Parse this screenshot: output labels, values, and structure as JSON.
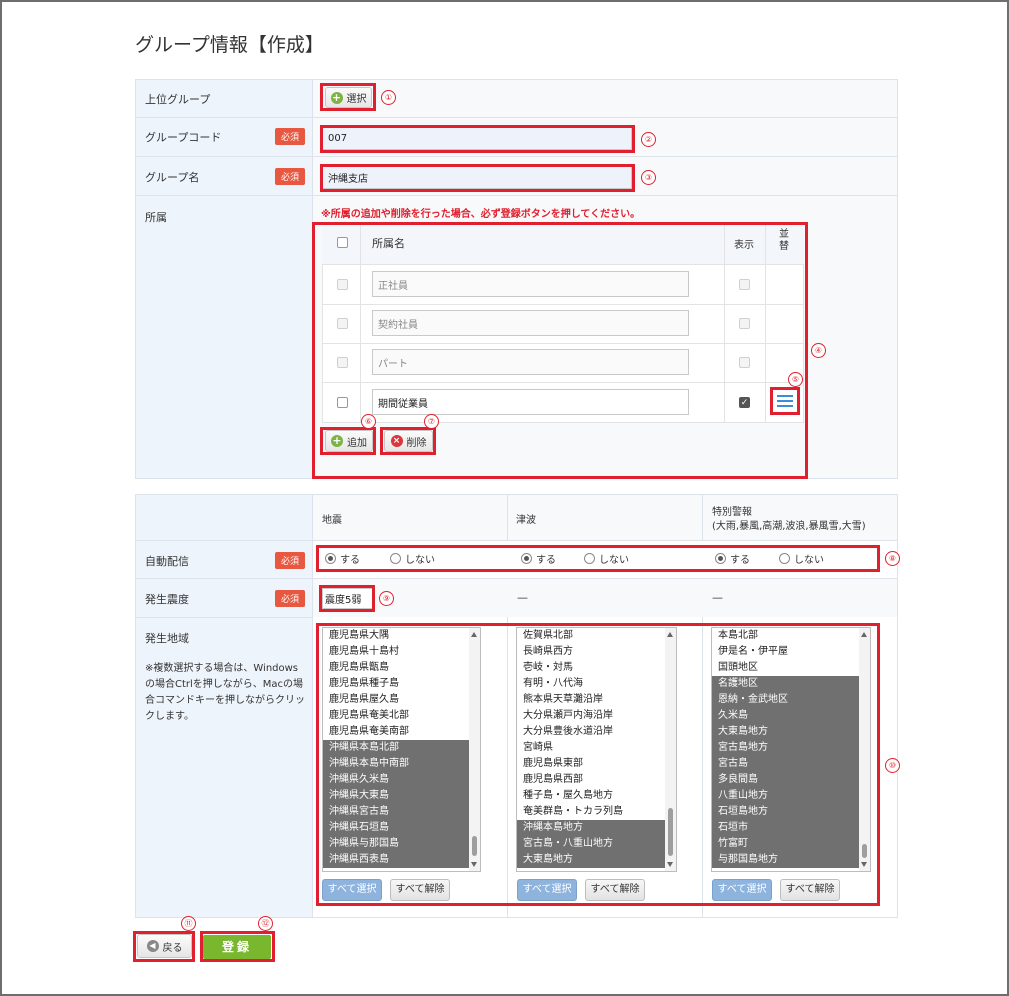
{
  "page_title": "グループ情報【作成】",
  "form": {
    "parent_group": {
      "label": "上位グループ",
      "button": "選択"
    },
    "group_code": {
      "label": "グループコード",
      "required": "必須",
      "value": "007"
    },
    "group_name": {
      "label": "グループ名",
      "required": "必須",
      "value": "沖縄支店"
    },
    "affiliation": {
      "label": "所属",
      "notice": "※所属の追加や削除を行った場合、必ず登録ボタンを押してください。",
      "col_name": "所属名",
      "col_display": "表示",
      "col_sort": "並替",
      "rows": [
        {
          "name": "正社員"
        },
        {
          "name": "契約社員"
        },
        {
          "name": "パート"
        },
        {
          "name": "期間従業員"
        }
      ],
      "add_button": "追加",
      "delete_button": "削除"
    }
  },
  "delivery": {
    "columns": {
      "quake": "地震",
      "tsunami": "津波",
      "warning": "特別警報",
      "warning_sub": "(大雨,暴風,高潮,波浪,暴風雪,大雪)"
    },
    "auto": {
      "label": "自動配信",
      "required": "必須",
      "yes": "する",
      "no": "しない"
    },
    "intensity": {
      "label": "発生震度",
      "required": "必須",
      "value": "震度5弱",
      "tsunami_value": "—",
      "warning_value": "—"
    },
    "region": {
      "label": "発生地域",
      "note": "※複数選択する場合は、Windowsの場合Ctrlを押しながら、Macの場合コマンドキーを押しながらクリックします。",
      "select_all": "すべて選択",
      "clear_all": "すべて解除",
      "quake_items": [
        {
          "t": "鹿児島県大隅",
          "s": false
        },
        {
          "t": "鹿児島県十島村",
          "s": false
        },
        {
          "t": "鹿児島県甑島",
          "s": false
        },
        {
          "t": "鹿児島県種子島",
          "s": false
        },
        {
          "t": "鹿児島県屋久島",
          "s": false
        },
        {
          "t": "鹿児島県奄美北部",
          "s": false
        },
        {
          "t": "鹿児島県奄美南部",
          "s": false
        },
        {
          "t": "沖縄県本島北部",
          "s": true
        },
        {
          "t": "沖縄県本島中南部",
          "s": true
        },
        {
          "t": "沖縄県久米島",
          "s": true
        },
        {
          "t": "沖縄県大東島",
          "s": true
        },
        {
          "t": "沖縄県宮古島",
          "s": true
        },
        {
          "t": "沖縄県石垣島",
          "s": true
        },
        {
          "t": "沖縄県与那国島",
          "s": true
        },
        {
          "t": "沖縄県西表島",
          "s": true
        }
      ],
      "tsunami_items": [
        {
          "t": "佐賀県北部",
          "s": false
        },
        {
          "t": "長崎県西方",
          "s": false
        },
        {
          "t": "壱岐・対馬",
          "s": false
        },
        {
          "t": "有明・八代海",
          "s": false
        },
        {
          "t": "熊本県天草灘沿岸",
          "s": false
        },
        {
          "t": "大分県瀬戸内海沿岸",
          "s": false
        },
        {
          "t": "大分県豊後水道沿岸",
          "s": false
        },
        {
          "t": "宮崎県",
          "s": false
        },
        {
          "t": "鹿児島県東部",
          "s": false
        },
        {
          "t": "鹿児島県西部",
          "s": false
        },
        {
          "t": "種子島・屋久島地方",
          "s": false
        },
        {
          "t": "奄美群島・トカラ列島",
          "s": false
        },
        {
          "t": "沖縄本島地方",
          "s": true
        },
        {
          "t": "宮古島・八重山地方",
          "s": true
        },
        {
          "t": "大東島地方",
          "s": true
        }
      ],
      "warning_items": [
        {
          "t": "本島北部",
          "s": false
        },
        {
          "t": "伊是名・伊平屋",
          "s": false
        },
        {
          "t": "国頭地区",
          "s": false
        },
        {
          "t": "名護地区",
          "s": true
        },
        {
          "t": "恩納・金武地区",
          "s": true
        },
        {
          "t": "久米島",
          "s": true
        },
        {
          "t": "大東島地方",
          "s": true
        },
        {
          "t": "宮古島地方",
          "s": true
        },
        {
          "t": "宮古島",
          "s": true
        },
        {
          "t": "多良間島",
          "s": true
        },
        {
          "t": "八重山地方",
          "s": true
        },
        {
          "t": "石垣島地方",
          "s": true
        },
        {
          "t": "石垣市",
          "s": true
        },
        {
          "t": "竹富町",
          "s": true
        },
        {
          "t": "与那国島地方",
          "s": true
        }
      ]
    }
  },
  "footer": {
    "back_button": "戻る",
    "submit_button": "登録"
  },
  "callouts": [
    "①",
    "②",
    "③",
    "④",
    "⑤",
    "⑥",
    "⑦",
    "⑧",
    "⑨",
    "⑩",
    "⑪",
    "⑫"
  ],
  "colors": {
    "highlight": "#e0202e",
    "required_badge": "#e8573f",
    "submit": "#79b72e",
    "label_bg": "#eef4fb",
    "selected_item": "#707070"
  }
}
